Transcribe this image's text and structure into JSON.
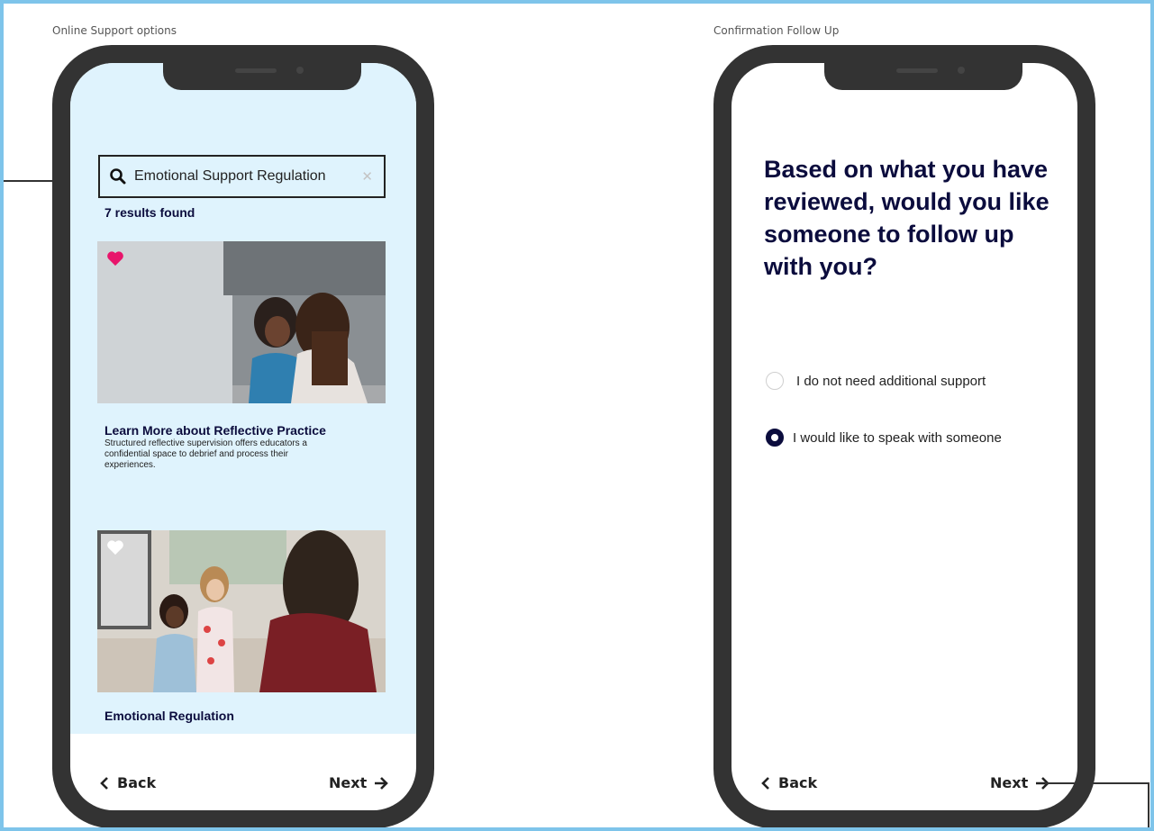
{
  "left_frame": {
    "label": "Online Support options",
    "search": {
      "query": "Emotional Support Regulation",
      "clear_icon": "close-icon"
    },
    "results_text": "7 results found",
    "cards": [
      {
        "title": "Learn More about Reflective Practice",
        "description": "Structured reflective supervision offers educators a confidential space to debrief and process their experiences.",
        "favorited": true
      },
      {
        "title": "Emotional Regulation",
        "description": "",
        "favorited": false
      }
    ],
    "back_label": "Back",
    "next_label": "Next"
  },
  "right_frame": {
    "label": "Confirmation Follow Up",
    "question": "Based on what you have reviewed, would you like someone to follow up with you?",
    "options": [
      {
        "label": "I do not need additional support",
        "selected": false
      },
      {
        "label": "I would like to speak with someone",
        "selected": true
      }
    ],
    "back_label": "Back",
    "next_label": "Next"
  },
  "colors": {
    "frame_border": "#7ec4ea",
    "phone_body": "#333333",
    "screen_tint": "#dff3fd",
    "heading_navy": "#0b0c3d",
    "heart_pink": "#e8156b"
  }
}
